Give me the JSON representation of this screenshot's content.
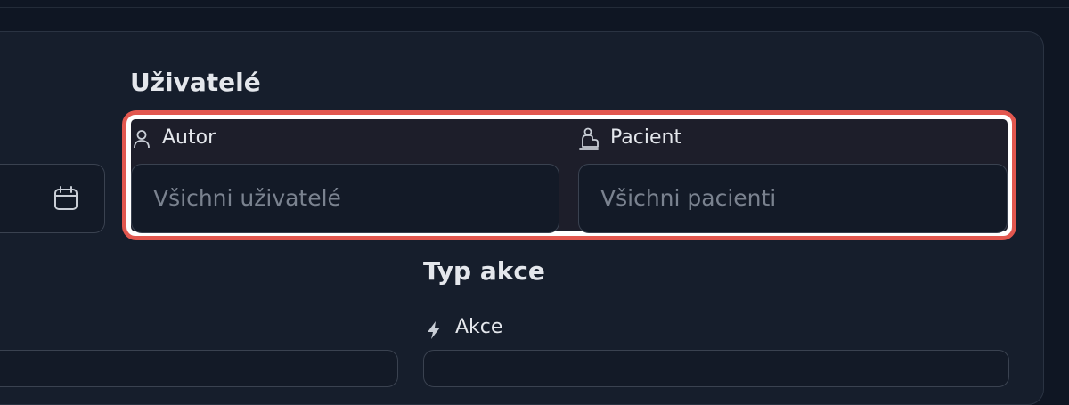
{
  "users_section": {
    "title": "Uživatelé",
    "author": {
      "label": "Autor",
      "placeholder": "Všichni uživatelé",
      "icon": "user-icon"
    },
    "patient": {
      "label": "Pacient",
      "placeholder": "Všichni pacienti",
      "icon": "patient-icon"
    }
  },
  "action_type_section": {
    "title": "Typ akce",
    "action": {
      "label": "Akce",
      "icon": "bolt-icon"
    }
  },
  "date_field": {
    "icon": "calendar-icon"
  },
  "colors": {
    "highlight_outer": "#e2574f",
    "highlight_inner": "#ffffff",
    "background": "#0f1623",
    "panel": "#161e2c"
  }
}
